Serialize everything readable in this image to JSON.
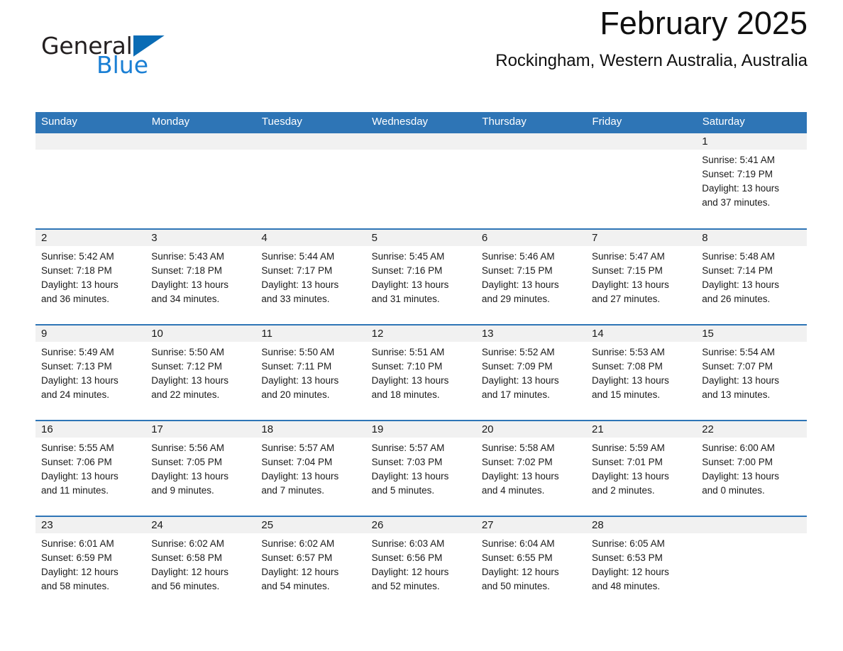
{
  "logo": {
    "word_black": "General",
    "word_blue": "Blue",
    "triangle_color": "#0a6cb5",
    "blue_color": "#1a7fd4"
  },
  "header": {
    "title": "February 2025",
    "subtitle": "Rockingham, Western Australia, Australia"
  },
  "theme": {
    "header_bar": "#2e75b6",
    "row_rule": "#2e75b6",
    "daynum_band": "#f1f1f1",
    "text": "#1a1a1a"
  },
  "daynames": [
    "Sunday",
    "Monday",
    "Tuesday",
    "Wednesday",
    "Thursday",
    "Friday",
    "Saturday"
  ],
  "weeks": [
    [
      {
        "day": "",
        "sunrise": "",
        "sunset": "",
        "daylight_1": "",
        "daylight_2": ""
      },
      {
        "day": "",
        "sunrise": "",
        "sunset": "",
        "daylight_1": "",
        "daylight_2": ""
      },
      {
        "day": "",
        "sunrise": "",
        "sunset": "",
        "daylight_1": "",
        "daylight_2": ""
      },
      {
        "day": "",
        "sunrise": "",
        "sunset": "",
        "daylight_1": "",
        "daylight_2": ""
      },
      {
        "day": "",
        "sunrise": "",
        "sunset": "",
        "daylight_1": "",
        "daylight_2": ""
      },
      {
        "day": "",
        "sunrise": "",
        "sunset": "",
        "daylight_1": "",
        "daylight_2": ""
      },
      {
        "day": "1",
        "sunrise": "Sunrise: 5:41 AM",
        "sunset": "Sunset: 7:19 PM",
        "daylight_1": "Daylight: 13 hours",
        "daylight_2": "and 37 minutes."
      }
    ],
    [
      {
        "day": "2",
        "sunrise": "Sunrise: 5:42 AM",
        "sunset": "Sunset: 7:18 PM",
        "daylight_1": "Daylight: 13 hours",
        "daylight_2": "and 36 minutes."
      },
      {
        "day": "3",
        "sunrise": "Sunrise: 5:43 AM",
        "sunset": "Sunset: 7:18 PM",
        "daylight_1": "Daylight: 13 hours",
        "daylight_2": "and 34 minutes."
      },
      {
        "day": "4",
        "sunrise": "Sunrise: 5:44 AM",
        "sunset": "Sunset: 7:17 PM",
        "daylight_1": "Daylight: 13 hours",
        "daylight_2": "and 33 minutes."
      },
      {
        "day": "5",
        "sunrise": "Sunrise: 5:45 AM",
        "sunset": "Sunset: 7:16 PM",
        "daylight_1": "Daylight: 13 hours",
        "daylight_2": "and 31 minutes."
      },
      {
        "day": "6",
        "sunrise": "Sunrise: 5:46 AM",
        "sunset": "Sunset: 7:15 PM",
        "daylight_1": "Daylight: 13 hours",
        "daylight_2": "and 29 minutes."
      },
      {
        "day": "7",
        "sunrise": "Sunrise: 5:47 AM",
        "sunset": "Sunset: 7:15 PM",
        "daylight_1": "Daylight: 13 hours",
        "daylight_2": "and 27 minutes."
      },
      {
        "day": "8",
        "sunrise": "Sunrise: 5:48 AM",
        "sunset": "Sunset: 7:14 PM",
        "daylight_1": "Daylight: 13 hours",
        "daylight_2": "and 26 minutes."
      }
    ],
    [
      {
        "day": "9",
        "sunrise": "Sunrise: 5:49 AM",
        "sunset": "Sunset: 7:13 PM",
        "daylight_1": "Daylight: 13 hours",
        "daylight_2": "and 24 minutes."
      },
      {
        "day": "10",
        "sunrise": "Sunrise: 5:50 AM",
        "sunset": "Sunset: 7:12 PM",
        "daylight_1": "Daylight: 13 hours",
        "daylight_2": "and 22 minutes."
      },
      {
        "day": "11",
        "sunrise": "Sunrise: 5:50 AM",
        "sunset": "Sunset: 7:11 PM",
        "daylight_1": "Daylight: 13 hours",
        "daylight_2": "and 20 minutes."
      },
      {
        "day": "12",
        "sunrise": "Sunrise: 5:51 AM",
        "sunset": "Sunset: 7:10 PM",
        "daylight_1": "Daylight: 13 hours",
        "daylight_2": "and 18 minutes."
      },
      {
        "day": "13",
        "sunrise": "Sunrise: 5:52 AM",
        "sunset": "Sunset: 7:09 PM",
        "daylight_1": "Daylight: 13 hours",
        "daylight_2": "and 17 minutes."
      },
      {
        "day": "14",
        "sunrise": "Sunrise: 5:53 AM",
        "sunset": "Sunset: 7:08 PM",
        "daylight_1": "Daylight: 13 hours",
        "daylight_2": "and 15 minutes."
      },
      {
        "day": "15",
        "sunrise": "Sunrise: 5:54 AM",
        "sunset": "Sunset: 7:07 PM",
        "daylight_1": "Daylight: 13 hours",
        "daylight_2": "and 13 minutes."
      }
    ],
    [
      {
        "day": "16",
        "sunrise": "Sunrise: 5:55 AM",
        "sunset": "Sunset: 7:06 PM",
        "daylight_1": "Daylight: 13 hours",
        "daylight_2": "and 11 minutes."
      },
      {
        "day": "17",
        "sunrise": "Sunrise: 5:56 AM",
        "sunset": "Sunset: 7:05 PM",
        "daylight_1": "Daylight: 13 hours",
        "daylight_2": "and 9 minutes."
      },
      {
        "day": "18",
        "sunrise": "Sunrise: 5:57 AM",
        "sunset": "Sunset: 7:04 PM",
        "daylight_1": "Daylight: 13 hours",
        "daylight_2": "and 7 minutes."
      },
      {
        "day": "19",
        "sunrise": "Sunrise: 5:57 AM",
        "sunset": "Sunset: 7:03 PM",
        "daylight_1": "Daylight: 13 hours",
        "daylight_2": "and 5 minutes."
      },
      {
        "day": "20",
        "sunrise": "Sunrise: 5:58 AM",
        "sunset": "Sunset: 7:02 PM",
        "daylight_1": "Daylight: 13 hours",
        "daylight_2": "and 4 minutes."
      },
      {
        "day": "21",
        "sunrise": "Sunrise: 5:59 AM",
        "sunset": "Sunset: 7:01 PM",
        "daylight_1": "Daylight: 13 hours",
        "daylight_2": "and 2 minutes."
      },
      {
        "day": "22",
        "sunrise": "Sunrise: 6:00 AM",
        "sunset": "Sunset: 7:00 PM",
        "daylight_1": "Daylight: 13 hours",
        "daylight_2": "and 0 minutes."
      }
    ],
    [
      {
        "day": "23",
        "sunrise": "Sunrise: 6:01 AM",
        "sunset": "Sunset: 6:59 PM",
        "daylight_1": "Daylight: 12 hours",
        "daylight_2": "and 58 minutes."
      },
      {
        "day": "24",
        "sunrise": "Sunrise: 6:02 AM",
        "sunset": "Sunset: 6:58 PM",
        "daylight_1": "Daylight: 12 hours",
        "daylight_2": "and 56 minutes."
      },
      {
        "day": "25",
        "sunrise": "Sunrise: 6:02 AM",
        "sunset": "Sunset: 6:57 PM",
        "daylight_1": "Daylight: 12 hours",
        "daylight_2": "and 54 minutes."
      },
      {
        "day": "26",
        "sunrise": "Sunrise: 6:03 AM",
        "sunset": "Sunset: 6:56 PM",
        "daylight_1": "Daylight: 12 hours",
        "daylight_2": "and 52 minutes."
      },
      {
        "day": "27",
        "sunrise": "Sunrise: 6:04 AM",
        "sunset": "Sunset: 6:55 PM",
        "daylight_1": "Daylight: 12 hours",
        "daylight_2": "and 50 minutes."
      },
      {
        "day": "28",
        "sunrise": "Sunrise: 6:05 AM",
        "sunset": "Sunset: 6:53 PM",
        "daylight_1": "Daylight: 12 hours",
        "daylight_2": "and 48 minutes."
      },
      {
        "day": "",
        "sunrise": "",
        "sunset": "",
        "daylight_1": "",
        "daylight_2": ""
      }
    ]
  ]
}
